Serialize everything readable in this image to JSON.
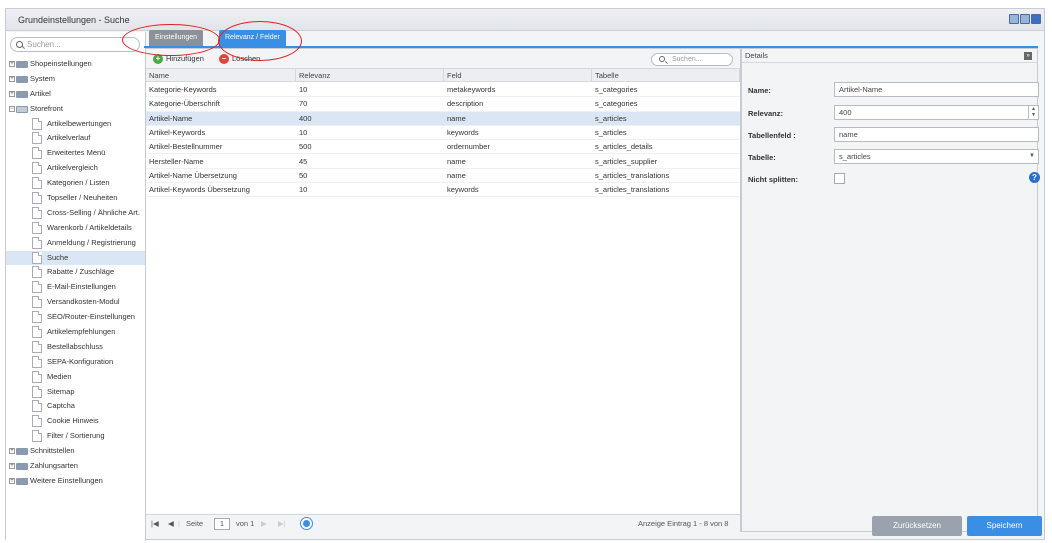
{
  "window": {
    "title": "Grundeinstellungen - Suche"
  },
  "sidebar": {
    "search_placeholder": "Suchen...",
    "items": [
      {
        "label": "Shopeinstellungen",
        "level": 0,
        "type": "folder",
        "expanded": false
      },
      {
        "label": "System",
        "level": 0,
        "type": "folder",
        "expanded": false
      },
      {
        "label": "Artikel",
        "level": 0,
        "type": "folder",
        "expanded": false
      },
      {
        "label": "Storefront",
        "level": 0,
        "type": "folder",
        "expanded": true
      },
      {
        "label": "Artikelbewertungen",
        "level": 1,
        "type": "leaf"
      },
      {
        "label": "Artikelverlauf",
        "level": 1,
        "type": "leaf"
      },
      {
        "label": "Erweitertes Menü",
        "level": 1,
        "type": "leaf"
      },
      {
        "label": "Artikelvergleich",
        "level": 1,
        "type": "leaf"
      },
      {
        "label": "Kategorien / Listen",
        "level": 1,
        "type": "leaf"
      },
      {
        "label": "Topseller / Neuheiten",
        "level": 1,
        "type": "leaf"
      },
      {
        "label": "Cross-Selling / Ähnliche Art.",
        "level": 1,
        "type": "leaf"
      },
      {
        "label": "Warenkorb / Artikeldetails",
        "level": 1,
        "type": "leaf"
      },
      {
        "label": "Anmeldung / Registrierung",
        "level": 1,
        "type": "leaf"
      },
      {
        "label": "Suche",
        "level": 1,
        "type": "leaf",
        "selected": true
      },
      {
        "label": "Rabatte / Zuschläge",
        "level": 1,
        "type": "leaf"
      },
      {
        "label": "E-Mail-Einstellungen",
        "level": 1,
        "type": "leaf"
      },
      {
        "label": "Versandkosten-Modul",
        "level": 1,
        "type": "leaf"
      },
      {
        "label": "SEO/Router-Einstellungen",
        "level": 1,
        "type": "leaf"
      },
      {
        "label": "Artikelempfehlungen",
        "level": 1,
        "type": "leaf"
      },
      {
        "label": "Bestellabschluss",
        "level": 1,
        "type": "leaf"
      },
      {
        "label": "SEPA-Konfiguration",
        "level": 1,
        "type": "leaf"
      },
      {
        "label": "Medien",
        "level": 1,
        "type": "leaf"
      },
      {
        "label": "Sitemap",
        "level": 1,
        "type": "leaf"
      },
      {
        "label": "Captcha",
        "level": 1,
        "type": "leaf"
      },
      {
        "label": "Cookie Hinweis",
        "level": 1,
        "type": "leaf"
      },
      {
        "label": "Filter / Sortierung",
        "level": 1,
        "type": "leaf"
      },
      {
        "label": "Schnittstellen",
        "level": 0,
        "type": "folder",
        "expanded": false
      },
      {
        "label": "Zahlungsarten",
        "level": 0,
        "type": "folder",
        "expanded": false
      },
      {
        "label": "Weitere Einstellungen",
        "level": 0,
        "type": "folder",
        "expanded": false
      }
    ]
  },
  "tabs": [
    {
      "label": "Einstellungen",
      "active": false
    },
    {
      "label": "Relevanz / Felder",
      "active": true
    }
  ],
  "toolbar": {
    "add_label": "Hinzufügen",
    "delete_label": "Löschen",
    "search_placeholder": "Suchen..."
  },
  "grid": {
    "columns": [
      "Name",
      "Relevanz",
      "Feld",
      "Tabelle"
    ],
    "rows": [
      {
        "name": "Kategorie-Keywords",
        "relevanz": "10",
        "feld": "metakeywords",
        "tabelle": "s_categories"
      },
      {
        "name": "Kategorie-Überschrift",
        "relevanz": "70",
        "feld": "description",
        "tabelle": "s_categories"
      },
      {
        "name": "Artikel-Name",
        "relevanz": "400",
        "feld": "name",
        "tabelle": "s_articles",
        "selected": true
      },
      {
        "name": "Artikel-Keywords",
        "relevanz": "10",
        "feld": "keywords",
        "tabelle": "s_articles"
      },
      {
        "name": "Artikel-Bestellnummer",
        "relevanz": "500",
        "feld": "ordernumber",
        "tabelle": "s_articles_details"
      },
      {
        "name": "Hersteller-Name",
        "relevanz": "45",
        "feld": "name",
        "tabelle": "s_articles_supplier"
      },
      {
        "name": "Artikel-Name Übersetzung",
        "relevanz": "50",
        "feld": "name",
        "tabelle": "s_articles_translations"
      },
      {
        "name": "Artikel-Keywords Übersetzung",
        "relevanz": "10",
        "feld": "keywords",
        "tabelle": "s_articles_translations"
      }
    ]
  },
  "pager": {
    "page_label": "Seite",
    "page_value": "1",
    "of_label": "von 1",
    "summary": "Anzeige Eintrag 1 - 8 von 8"
  },
  "details": {
    "title": "Details",
    "name_label": "Name:",
    "name_value": "Artikel-Name",
    "relevanz_label": "Relevanz:",
    "relevanz_value": "400",
    "feld_label": "Tabellenfeld :",
    "feld_value": "name",
    "tabelle_label": "Tabelle:",
    "tabelle_value": "s_articles",
    "split_label": "Nicht splitten:",
    "reset_label": "Zurücksetzen",
    "save_label": "Speichern"
  },
  "colors": {
    "accent": "#3a8ee6",
    "selected_row": "#dbe6f4",
    "annotation": "#e02020"
  }
}
